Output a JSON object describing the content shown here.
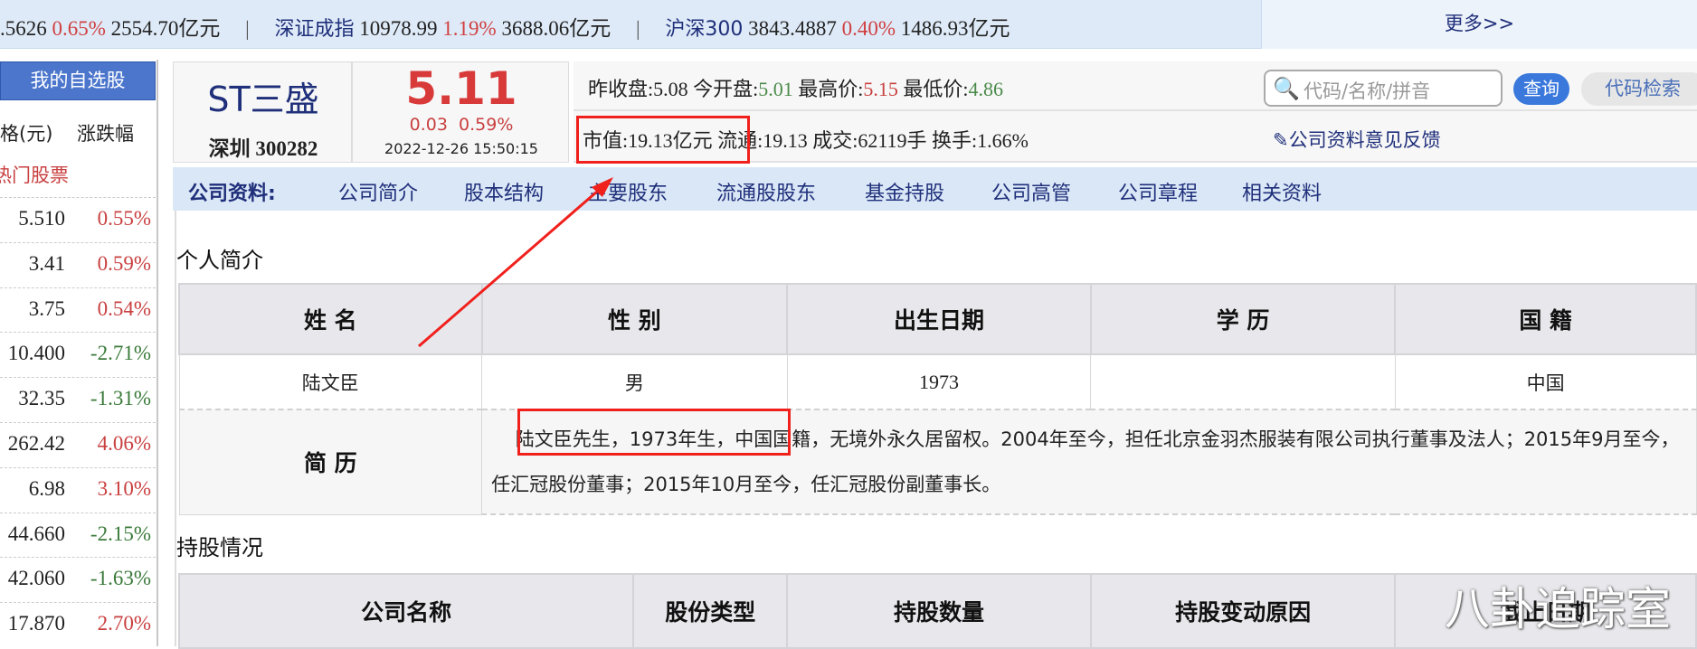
{
  "ticker": {
    "sh": {
      "value": ".5626",
      "pct": "0.65%",
      "amount": "2554.70亿元"
    },
    "sz": {
      "name": "深证成指",
      "value": "10978.99",
      "pct": "1.19%",
      "amount": "3688.06亿元"
    },
    "hs300": {
      "name": "沪深300",
      "value": "3843.4887",
      "pct": "0.40%",
      "amount": "1486.93亿元"
    },
    "separator": "|",
    "more": "更多>>"
  },
  "sidebar": {
    "title": "我的自选股",
    "col_price": "格(元)",
    "col_change": "涨跌幅",
    "section": "热门股票",
    "rows": [
      {
        "price": "5.510",
        "change": "0.55%",
        "dir": "up"
      },
      {
        "price": "3.41",
        "change": "0.59%",
        "dir": "up"
      },
      {
        "price": "3.75",
        "change": "0.54%",
        "dir": "up"
      },
      {
        "price": "10.400",
        "change": "-2.71%",
        "dir": "dn"
      },
      {
        "price": "32.35",
        "change": "-1.31%",
        "dir": "dn"
      },
      {
        "price": "262.42",
        "change": "4.06%",
        "dir": "up"
      },
      {
        "price": "6.98",
        "change": "3.10%",
        "dir": "up"
      },
      {
        "price": "44.660",
        "change": "-2.15%",
        "dir": "dn"
      },
      {
        "price": "42.060",
        "change": "-1.63%",
        "dir": "dn"
      },
      {
        "price": "17.870",
        "change": "2.70%",
        "dir": "up"
      }
    ]
  },
  "stock": {
    "name": "ST三盛",
    "code": "深圳 300282",
    "price": "5.11",
    "change": "0.03",
    "change_pct": "0.59%",
    "datetime": "2022-12-26 15:50:15",
    "prev_close_label": "昨收盘:",
    "prev_close": "5.08",
    "open_label": "今开盘:",
    "open": "5.01",
    "high_label": "最高价:",
    "high": "5.15",
    "low_label": "最低价:",
    "low": "4.86",
    "mktcap": "市值:19.13亿元",
    "float": "流通:19.13",
    "volume": "成交:62119手",
    "turnover": "换手:1.66%"
  },
  "search": {
    "placeholder": "代码/名称/拼音",
    "query_button": "查询",
    "code_button": "代码检索",
    "feedback": "公司资料意见反馈"
  },
  "nav": {
    "label": "公司资料:",
    "items": [
      "公司简介",
      "股本结构",
      "主要股东",
      "流通股股东",
      "基金持股",
      "公司高管",
      "公司章程",
      "相关资料"
    ]
  },
  "profile": {
    "title": "个人简介",
    "headers": [
      "姓 名",
      "性 别",
      "出生日期",
      "学 历",
      "国 籍"
    ],
    "row": [
      "陆文臣",
      "男",
      "1973",
      "",
      "中国"
    ],
    "bio_label": "简 历",
    "bio_highlight": "陆文臣先生，1973年生，",
    "bio_rest": "中国国籍，无境外永久居留权。2004年至今，担任北京金羽杰服装有限公司执行董事及法人；2015年9月至今，任汇冠股份董事；2015年10月至今，任汇冠股份副董事长。"
  },
  "holdings": {
    "title": "持股情况",
    "headers": [
      "公司名称",
      "股份类型",
      "持股数量",
      "持股变动原因",
      "截止日期"
    ]
  },
  "watermark": "八卦追踪室",
  "colors": {
    "up": "#c94040",
    "down": "#3a7a3a",
    "annotation": "#f0201c",
    "nav_bg": "#dae7f7"
  }
}
